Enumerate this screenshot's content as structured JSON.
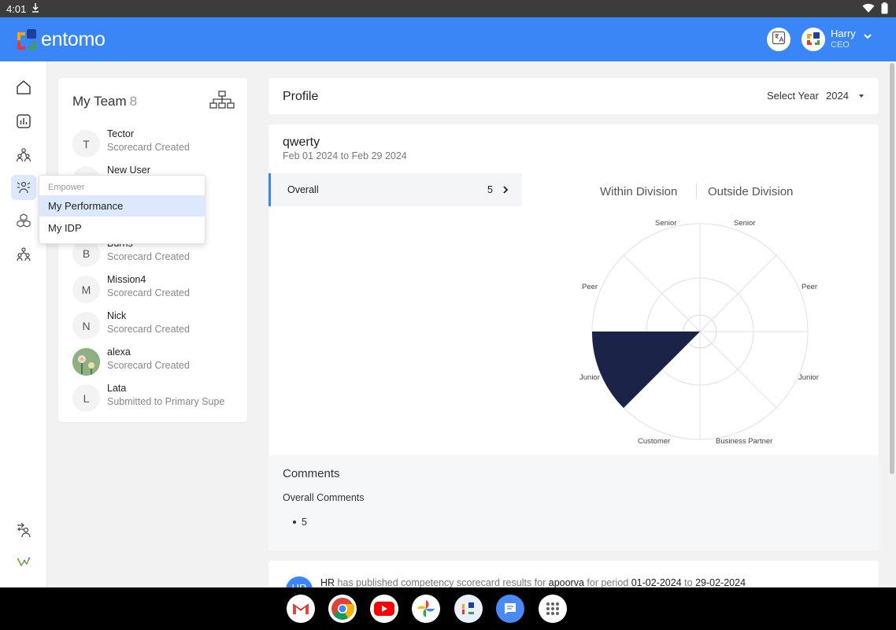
{
  "status_bar": {
    "time": "4:01"
  },
  "header": {
    "app_name": "entomo",
    "user_name": "Harry",
    "user_role": "CEO",
    "accent_color": "#3a86f7"
  },
  "nav_icons": [
    "home-icon",
    "chart-icon",
    "team-icon",
    "empower-icon",
    "cubes-icon",
    "org-people-icon",
    "switch-user-icon",
    "analytics-icon"
  ],
  "team": {
    "title": "My Team",
    "count": "8",
    "members": [
      {
        "initial": "T",
        "name": "Tector",
        "status": "Scorecard Created"
      },
      {
        "initial": "N",
        "name": "New User",
        "status": ""
      },
      {
        "initial": "B",
        "name": "Burns",
        "status": "Scorecard Created"
      },
      {
        "initial": "M",
        "name": "Mission4",
        "status": "Scorecard Created"
      },
      {
        "initial": "N",
        "name": "Nick",
        "status": "Scorecard Created"
      },
      {
        "initial": "",
        "name": "alexa",
        "status": "Scorecard Created"
      },
      {
        "initial": "L",
        "name": "Lata",
        "status": "Submitted to Primary Supe"
      }
    ]
  },
  "popup": {
    "header": "Empower",
    "items": [
      "My Performance",
      "My IDP"
    ]
  },
  "profile": {
    "title": "Profile",
    "year_label": "Select Year",
    "year_value": "2024"
  },
  "scorecard": {
    "name": "qwerty",
    "period": "Feb 01 2024 to Feb 29 2024",
    "overall_label": "Overall",
    "overall_value": "5",
    "tabs": [
      "Within Division",
      "Outside Division"
    ],
    "radar_labels": {
      "senior_left": "Senior",
      "senior_right": "Senior",
      "peer_left": "Peer",
      "peer_right": "Peer",
      "junior_left": "Junior",
      "junior_right": "Junior",
      "customer": "Customer",
      "business_partner": "Business Partner"
    },
    "fill_color": "#1b2448"
  },
  "comments": {
    "title": "Comments",
    "subtitle": "Overall Comments",
    "items": [
      "5"
    ]
  },
  "feed": {
    "avatar": "HR",
    "actor": "HR",
    "text1": "has published competency scorecard results for",
    "subject": "apoorva",
    "text2": "for period",
    "from": "01-02-2024",
    "text3": "to",
    "to": "29-02-2024"
  },
  "dock_apps": [
    "gmail-icon",
    "chrome-icon",
    "youtube-icon",
    "photos-icon",
    "entomo-app-icon",
    "messages-icon",
    "app-drawer-icon"
  ]
}
